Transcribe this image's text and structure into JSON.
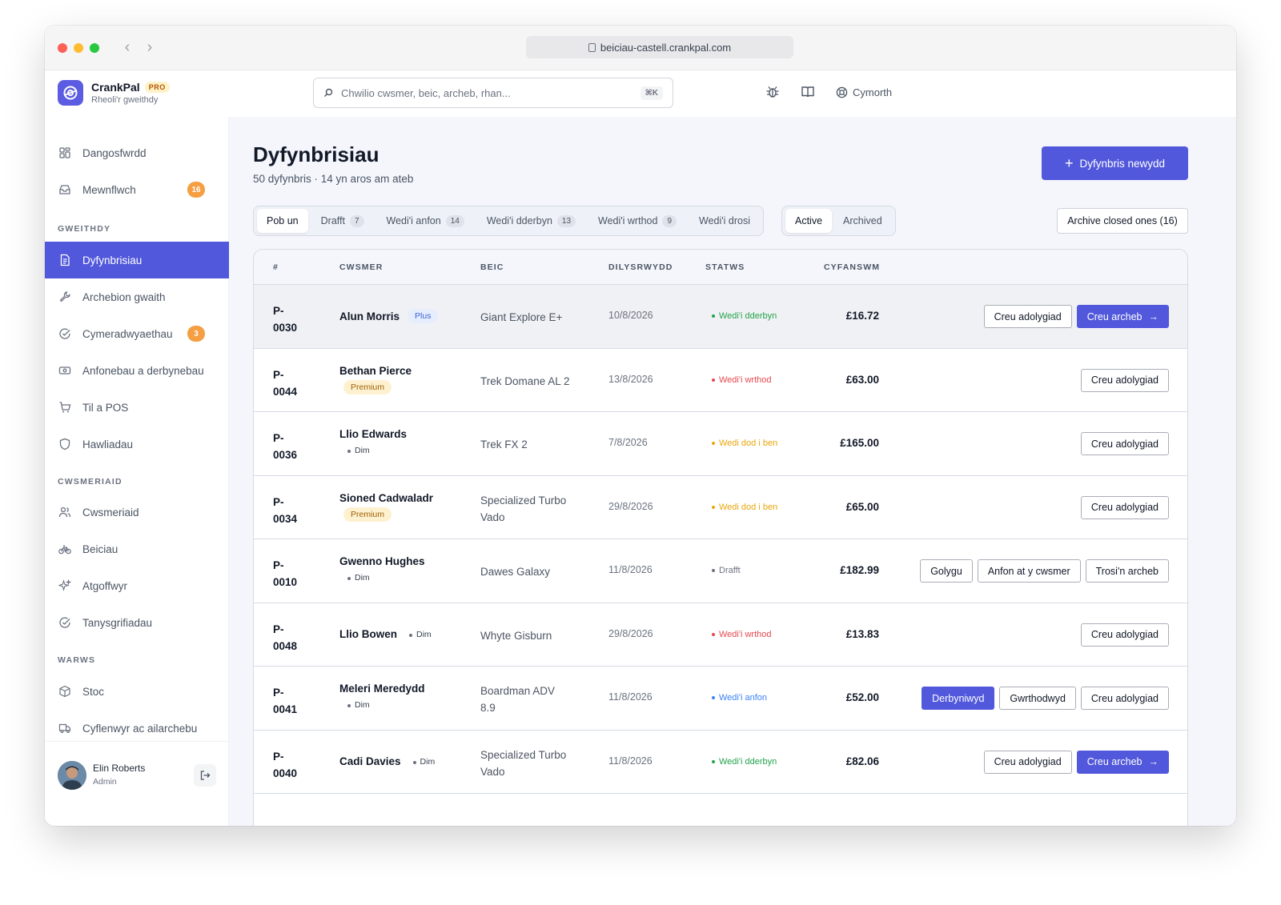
{
  "browser": {
    "url": "beiciau-castell.crankpal.com",
    "back_icon": "‹",
    "forward_icon": "›"
  },
  "app": {
    "name": "CrankPal",
    "badge": "PRO",
    "subtitle": "Rheoli'r gweithdy"
  },
  "search": {
    "placeholder": "Chwilio cwsmer, beic, archeb, rhan...",
    "shortcut": "⌘K"
  },
  "topbar": {
    "help_label": "Cymorth"
  },
  "sidebar": {
    "items": [
      {
        "label": "Dangosfwrdd",
        "icon": "dashboard-icon"
      },
      {
        "label": "Mewnflwch",
        "icon": "inbox-icon",
        "count": "16"
      }
    ],
    "sections": [
      {
        "title": "GWEITHDY",
        "items": [
          {
            "label": "Dyfynbrisiau",
            "icon": "document-icon",
            "active": true
          },
          {
            "label": "Archebion gwaith",
            "icon": "wrench-icon"
          },
          {
            "label": "Cymeradwyaethau",
            "icon": "check-circle-icon",
            "count": "3"
          },
          {
            "label": "Anfonebau a derbynebau",
            "icon": "cash-icon"
          },
          {
            "label": "Til a POS",
            "icon": "cart-icon"
          },
          {
            "label": "Hawliadau",
            "icon": "shield-icon"
          }
        ]
      },
      {
        "title": "CWSMERIAID",
        "items": [
          {
            "label": "Cwsmeriaid",
            "icon": "users-icon"
          },
          {
            "label": "Beiciau",
            "icon": "bike-icon"
          },
          {
            "label": "Atgoffwyr",
            "icon": "sparkle-icon"
          },
          {
            "label": "Tanysgrifiadau",
            "icon": "check-circle-icon"
          }
        ]
      },
      {
        "title": "WARWS",
        "items": [
          {
            "label": "Stoc",
            "icon": "box-icon"
          },
          {
            "label": "Cyflenwyr ac ailarchebu",
            "icon": "truck-icon"
          }
        ]
      }
    ],
    "user": {
      "name": "Elin Roberts",
      "role": "Admin"
    }
  },
  "page": {
    "title": "Dyfynbrisiau",
    "subtitle": "50 dyfynbris · 14 yn aros am ateb",
    "new_button": "Dyfynbris newydd",
    "archive_button": "Archive closed ones (16)"
  },
  "tabs": [
    {
      "label": "Pob un",
      "active": true
    },
    {
      "label": "Drafft",
      "count": "7"
    },
    {
      "label": "Wedi'i anfon",
      "count": "14"
    },
    {
      "label": "Wedi'i dderbyn",
      "count": "13"
    },
    {
      "label": "Wedi'i wrthod",
      "count": "9"
    },
    {
      "label": "Wedi'i drosi"
    }
  ],
  "segment": [
    {
      "label": "Active",
      "active": true
    },
    {
      "label": "Archived"
    }
  ],
  "table": {
    "headers": [
      "#",
      "CWSMER",
      "BEIC",
      "DILYSRWYDD",
      "STATWS",
      "CYFANSWM"
    ],
    "rows": [
      {
        "id1": "P-",
        "id2": "0030",
        "customer": "Alun Morris",
        "tier": "Plus",
        "tier_style": "plus",
        "tier_inline": true,
        "bike1": "Giant Explore E+",
        "bike2": "",
        "date": "10/8/2026",
        "status": "Wedi'i dderbyn",
        "status_color": "#22a34a",
        "total": "£16.72",
        "actions": [
          {
            "label": "Creu adolygiad"
          },
          {
            "label": "Creu archeb",
            "primary": true,
            "arrow": true
          }
        ],
        "hover": true
      },
      {
        "id1": "P-",
        "id2": "0044",
        "customer": "Bethan Pierce",
        "tier": "Premium",
        "tier_style": "premium",
        "tier_inline": false,
        "bike1": "Trek Domane AL 2",
        "bike2": "",
        "date": "13/8/2026",
        "status": "Wedi'i wrthod",
        "status_color": "#e5484d",
        "total": "£63.00",
        "actions": [
          {
            "label": "Creu adolygiad"
          }
        ]
      },
      {
        "id1": "P-",
        "id2": "0036",
        "customer": "Llio Edwards",
        "tier": "Dim",
        "tier_style": "none",
        "tier_inline": false,
        "bike1": "Trek FX 2",
        "bike2": "",
        "date": "7/8/2026",
        "status": "Wedi dod i ben",
        "status_color": "#e9a70b",
        "total": "£165.00",
        "actions": [
          {
            "label": "Creu adolygiad"
          }
        ]
      },
      {
        "id1": "P-",
        "id2": "0034",
        "customer": "Sioned Cadwaladr",
        "tier": "Premium",
        "tier_style": "premium",
        "tier_inline": false,
        "bike1": "Specialized Turbo",
        "bike2": "Vado",
        "date": "29/8/2026",
        "status": "Wedi dod i ben",
        "status_color": "#e9a70b",
        "total": "£65.00",
        "actions": [
          {
            "label": "Creu adolygiad"
          }
        ]
      },
      {
        "id1": "P-",
        "id2": "0010",
        "customer": "Gwenno Hughes",
        "tier": "Dim",
        "tier_style": "none",
        "tier_inline": false,
        "bike1": "Dawes Galaxy",
        "bike2": "",
        "date": "11/8/2026",
        "status": "Drafft",
        "status_color": "#6b7280",
        "total": "£182.99",
        "actions": [
          {
            "label": "Golygu"
          },
          {
            "label": "Anfon at y cwsmer"
          },
          {
            "label": "Trosi'n archeb"
          }
        ]
      },
      {
        "id1": "P-",
        "id2": "0048",
        "customer": "Llio Bowen",
        "tier": "Dim",
        "tier_style": "none",
        "tier_inline": true,
        "bike1": "Whyte Gisburn",
        "bike2": "",
        "date": "29/8/2026",
        "status": "Wedi'i wrthod",
        "status_color": "#e5484d",
        "total": "£13.83",
        "actions": [
          {
            "label": "Creu adolygiad"
          }
        ]
      },
      {
        "id1": "P-",
        "id2": "0041",
        "customer": "Meleri Meredydd",
        "tier": "Dim",
        "tier_style": "none",
        "tier_inline": false,
        "bike1": "Boardman ADV",
        "bike2": "8.9",
        "date": "11/8/2026",
        "status": "Wedi'i anfon",
        "status_color": "#3b82f6",
        "total": "£52.00",
        "actions": [
          {
            "label": "Derbyniwyd",
            "primary": true
          },
          {
            "label": "Gwrthodwyd"
          },
          {
            "label": "Creu adolygiad"
          }
        ]
      },
      {
        "id1": "P-",
        "id2": "0040",
        "customer": "Cadi Davies",
        "tier": "Dim",
        "tier_style": "none",
        "tier_inline": true,
        "bike1": "Specialized Turbo",
        "bike2": "Vado",
        "date": "11/8/2026",
        "status": "Wedi'i dderbyn",
        "status_color": "#22a34a",
        "total": "£82.06",
        "actions": [
          {
            "label": "Creu adolygiad"
          },
          {
            "label": "Creu archeb",
            "primary": true,
            "arrow": true
          }
        ]
      }
    ]
  }
}
